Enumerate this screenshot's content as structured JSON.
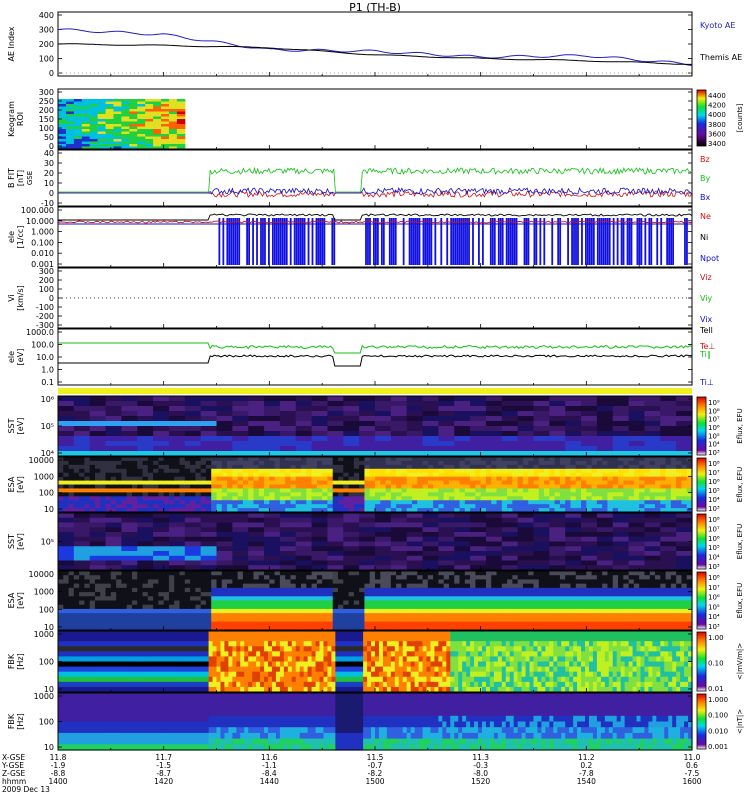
{
  "title": "P1 (TH-B)",
  "x_axis": {
    "rows": [
      {
        "label": "X-GSE",
        "values": [
          "11.8",
          "11.7",
          "11.6",
          "11.5",
          "11.3",
          "11.2",
          "11.0"
        ]
      },
      {
        "label": "Y-GSE",
        "values": [
          "-1.9",
          "-1.5",
          "-1.1",
          "-0.7",
          "-0.3",
          "0.2",
          "0.6"
        ]
      },
      {
        "label": "Z-GSE",
        "values": [
          "-8.8",
          "-8.7",
          "-8.4",
          "-8.2",
          "-8.0",
          "-7.8",
          "-7.5"
        ]
      },
      {
        "label": "hhmm",
        "values": [
          "1400",
          "1420",
          "1440",
          "1500",
          "1520",
          "1540",
          "1600"
        ]
      }
    ],
    "date": "2009 Dec 13"
  },
  "chart_data": [
    {
      "panel": "ae",
      "type": "line",
      "ylabel": "AE Index",
      "ylim": [
        0,
        400
      ],
      "yticks": [
        "400",
        "300",
        "200",
        "100",
        "0"
      ],
      "x": [
        "1400",
        "1420",
        "1440",
        "1500",
        "1520",
        "1540",
        "1600"
      ],
      "series": [
        {
          "name": "Kyoto AE",
          "color": "#2020c8",
          "values": [
            300,
            265,
            160,
            150,
            110,
            120,
            60
          ]
        },
        {
          "name": "Themis AE",
          "color": "#000000",
          "values": [
            200,
            190,
            175,
            125,
            100,
            85,
            60
          ]
        }
      ]
    },
    {
      "panel": "keogram",
      "type": "heatmap",
      "ylabel": "Keogram",
      "yunit": "ROI",
      "yticks": [
        "300",
        "250",
        "200",
        "150",
        "100",
        "50",
        "0"
      ],
      "colorbar": {
        "label": "[counts]",
        "ticks": [
          "4400",
          "4200",
          "4000",
          "3800",
          "3600",
          "3400"
        ]
      },
      "x_range": [
        "1400",
        "1425"
      ]
    },
    {
      "panel": "b",
      "type": "line",
      "ylabel": "B FIT",
      "yunit": "[nT]",
      "coord": "GSE",
      "ylim": [
        -10,
        40
      ],
      "yticks": [
        "40",
        "30",
        "20",
        "10",
        "0",
        "-10"
      ],
      "series": [
        {
          "name": "Bz",
          "color": "#d01010"
        },
        {
          "name": "By",
          "color": "#10c010"
        },
        {
          "name": "Bx",
          "color": "#1010d0"
        }
      ]
    },
    {
      "panel": "density",
      "type": "line",
      "ylabel": "ele",
      "yunit": "[1/cc]",
      "yticks": [
        "100.000",
        "10.000",
        "1.000",
        "0.100",
        "0.010",
        "0.001"
      ],
      "series": [
        {
          "name": "Ne",
          "color": "#d01010"
        },
        {
          "name": "Ni",
          "color": "#000000"
        },
        {
          "name": "Npot",
          "color": "#1010d0"
        }
      ]
    },
    {
      "panel": "velocity",
      "type": "line",
      "ylabel": "Vi",
      "yunit": "[km/s]",
      "ylim": [
        -300,
        300
      ],
      "yticks": [
        "300",
        "200",
        "100",
        "0",
        "-100",
        "-200",
        "-300"
      ],
      "series": [
        {
          "name": "Viz",
          "color": "#d01010"
        },
        {
          "name": "Viy",
          "color": "#10c010"
        },
        {
          "name": "Vix",
          "color": "#1010d0"
        }
      ]
    },
    {
      "panel": "temperature",
      "type": "line",
      "ylabel": "ele",
      "yunit": "[eV]",
      "yticks": [
        "1000.0",
        "100.0",
        "10.0",
        "1.0",
        "0.1"
      ],
      "series": [
        {
          "name": "Tell",
          "color": "#000000"
        },
        {
          "name": "Te⊥",
          "color": "#d01010"
        },
        {
          "name": "Ti∥",
          "color": "#10c010"
        },
        {
          "name": "Ti⊥",
          "color": "#1010d0"
        }
      ]
    },
    {
      "panel": "sst_e",
      "type": "heatmap",
      "ylabel": "SST",
      "yunit": "[eV]",
      "yticks": [
        "10⁶",
        "10⁵",
        "10⁴"
      ],
      "colorbar": {
        "label": "Eflux, EFU",
        "ticks": [
          "10⁹",
          "10⁸",
          "10⁷",
          "10⁶",
          "10⁵",
          "10⁴",
          "10³"
        ]
      }
    },
    {
      "panel": "esa_e",
      "type": "heatmap",
      "ylabel": "ESA",
      "yunit": "[eV]",
      "yticks": [
        "10000",
        "1000",
        "100",
        "10"
      ],
      "colorbar": {
        "label": "Eflux, EFU",
        "ticks": [
          "10⁸",
          "10⁷",
          "10⁶",
          "10⁵",
          "10⁴",
          "10³"
        ]
      }
    },
    {
      "panel": "sst_i",
      "type": "heatmap",
      "ylabel": "SST",
      "yunit": "[eV]",
      "yticks": [
        "10⁵"
      ],
      "colorbar": {
        "label": "Eflux, EFU",
        "ticks": [
          "10⁸",
          "10⁷",
          "10⁶",
          "10⁵",
          "10⁴",
          "10³"
        ]
      }
    },
    {
      "panel": "esa_i",
      "type": "heatmap",
      "ylabel": "ESA",
      "yunit": "[eV]",
      "yticks": [
        "10000",
        "1000",
        "100",
        "10"
      ],
      "colorbar": {
        "label": "Eflux, EFU",
        "ticks": [
          "10⁸",
          "10⁷",
          "10⁶",
          "10⁵",
          "10⁴",
          "10³"
        ]
      }
    },
    {
      "panel": "fbk_e",
      "type": "heatmap",
      "ylabel": "FBK",
      "yunit": "[Hz]",
      "yticks": [
        "1000",
        "100",
        "10"
      ],
      "colorbar": {
        "label": "<|mV/m|>",
        "ticks": [
          "1.00",
          "0.10",
          "0.01"
        ]
      }
    },
    {
      "panel": "fbk_b",
      "type": "heatmap",
      "ylabel": "FBK",
      "yunit": "[Hz]",
      "yticks": [
        "1000",
        "100",
        "10"
      ],
      "colorbar": {
        "label": "<|nT|>",
        "ticks": [
          "1.000",
          "0.100",
          "0.010",
          "0.001"
        ]
      }
    }
  ]
}
